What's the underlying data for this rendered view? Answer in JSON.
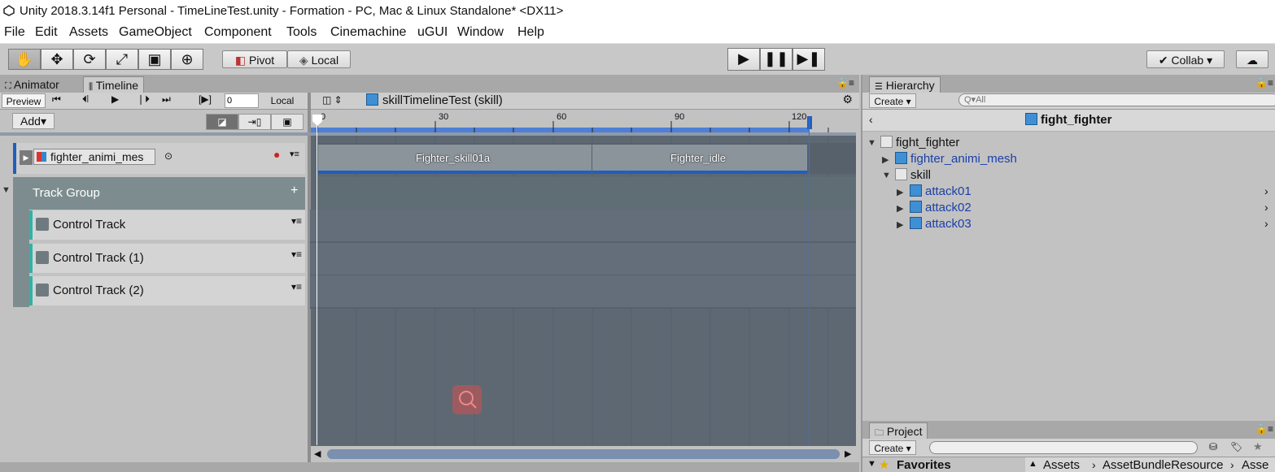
{
  "window": {
    "title": "Unity 2018.3.14f1 Personal - TimeLineTest.unity - Formation - PC, Mac & Linux Standalone* <DX11>"
  },
  "menu": [
    "File",
    "Edit",
    "Assets",
    "GameObject",
    "Component",
    "Tools",
    "Cinemachine",
    "uGUI",
    "Window",
    "Help"
  ],
  "toolbar": {
    "pivot_label": "Pivot",
    "local_label": "Local",
    "collab_label": "Collab ▾"
  },
  "timeline": {
    "tabs": {
      "animator": "Animator",
      "timeline": "Timeline"
    },
    "preview_label": "Preview",
    "frame_value": "0",
    "local_label": "Local",
    "asset_name": "skillTimelineTest (skill)",
    "add_label": "Add▾",
    "ruler_ticks": [
      "0",
      "30",
      "60",
      "90",
      "120"
    ],
    "animation_track_label": "fighter_animi_mes",
    "clips": [
      "Fighter_skill01a",
      "Fighter_idle"
    ],
    "group_label": "Track Group",
    "group_add": "+",
    "tracks": [
      "Control Track",
      "Control Track (1)",
      "Control Track (2)"
    ]
  },
  "hierarchy": {
    "tab_label": "Hierarchy",
    "create_label": "Create ▾",
    "search_placeholder": "Q▾All",
    "scene_title": "fight_fighter",
    "items": {
      "root": "fight_fighter",
      "mesh": "fighter_animi_mesh",
      "skill": "skill",
      "attack01": "attack01",
      "attack02": "attack02",
      "attack03": "attack03"
    }
  },
  "project": {
    "tab_label": "Project",
    "create_label": "Create ▾",
    "favorites_label": "Favorites",
    "breadcrumb": [
      "Assets",
      "AssetBundleResource",
      "Asse"
    ]
  },
  "colors": {
    "track_accent": "#2fb3a6",
    "clip_blue": "#1f5fbf",
    "playhead": "#ffffff",
    "lane_bg": "#636e7a"
  }
}
